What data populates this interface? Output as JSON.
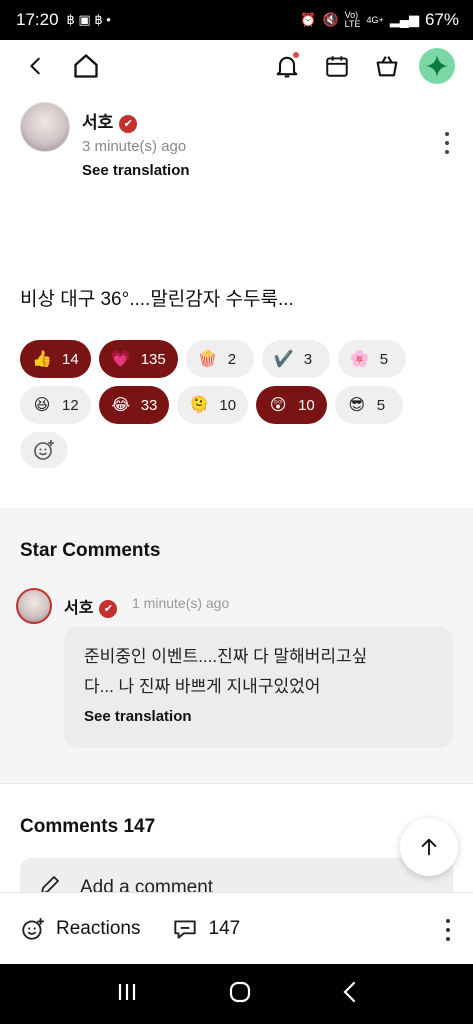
{
  "status_bar": {
    "time": "17:20",
    "battery": "67%",
    "net_top": "Vo)",
    "net_bottom": "LTE",
    "gen": "4G+"
  },
  "post": {
    "author": "서호",
    "time": "3 minute(s) ago",
    "see_translation": "See translation",
    "body": "비상 대구 36°....말린감자 수두룩..."
  },
  "reactions": {
    "row1": [
      {
        "emoji": "👍",
        "count": "14",
        "active": true
      },
      {
        "emoji": "💗",
        "count": "135",
        "active": true
      },
      {
        "emoji": "🍿",
        "count": "2",
        "active": false
      },
      {
        "emoji": "✔️",
        "count": "3",
        "active": false
      },
      {
        "emoji": "🌸",
        "count": "5",
        "active": false
      }
    ],
    "row2": [
      {
        "emoji": "😆",
        "count": "12",
        "active": false
      },
      {
        "emoji": "😂",
        "count": "33",
        "active": true
      },
      {
        "emoji": "🫠",
        "count": "10",
        "active": false
      },
      {
        "emoji": "😲",
        "count": "10",
        "active": true
      },
      {
        "emoji": "😎",
        "count": "5",
        "active": false
      }
    ]
  },
  "star_comments": {
    "title": "Star Comments",
    "author": "서호",
    "time": "1 minute(s) ago",
    "line1": "준비중인 이벤트....진짜 다 말해버리고싶",
    "line2": "다... 나 진짜 바쁘게 지내구있었어",
    "see_translation": "See translation"
  },
  "comments": {
    "title": "Comments 147",
    "placeholder": "Add a comment"
  },
  "bottom_bar": {
    "reactions_label": "Reactions",
    "comment_count": "147"
  },
  "icons": [
    "back-icon",
    "home-icon",
    "bell-icon",
    "calendar-icon",
    "shop-bag-icon",
    "gem-icon",
    "verified-icon",
    "more-icon",
    "add-reaction-icon",
    "pencil-icon",
    "arrow-up-icon",
    "comment-icon",
    "recents-icon",
    "home-circle-icon",
    "nav-back-icon"
  ],
  "colors": {
    "accent_red": "#7a1414",
    "verified": "#c4302b",
    "gem": "#7bd7a5",
    "notif_dot": "#e5484d"
  }
}
